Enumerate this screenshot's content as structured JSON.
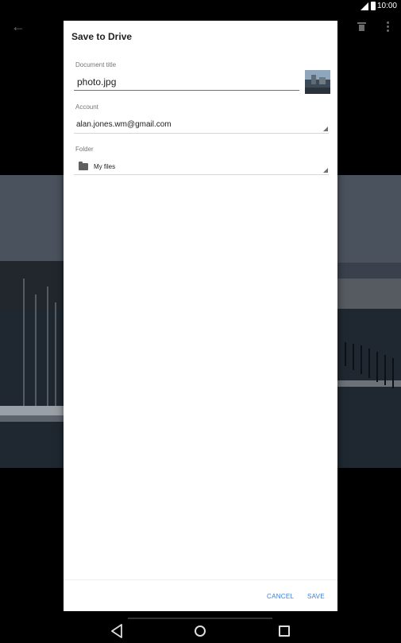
{
  "status_bar": {
    "time": "10:00"
  },
  "dialog": {
    "title": "Save to Drive",
    "document_title_label": "Document title",
    "document_title_value": "photo.jpg",
    "account_label": "Account",
    "account_value": "alan.jones.wm@gmail.com",
    "folder_label": "Folder",
    "folder_value": "My files",
    "cancel_label": "CANCEL",
    "save_label": "SAVE"
  },
  "icons": {
    "back": "back-arrow-icon",
    "trash": "trash-icon",
    "more": "more-vert-icon",
    "folder": "folder-icon",
    "signal": "signal-icon",
    "battery": "battery-icon"
  },
  "colors": {
    "accent": "#3d7bd9",
    "dialog_bg": "#ffffff",
    "scrim": "#000000"
  }
}
